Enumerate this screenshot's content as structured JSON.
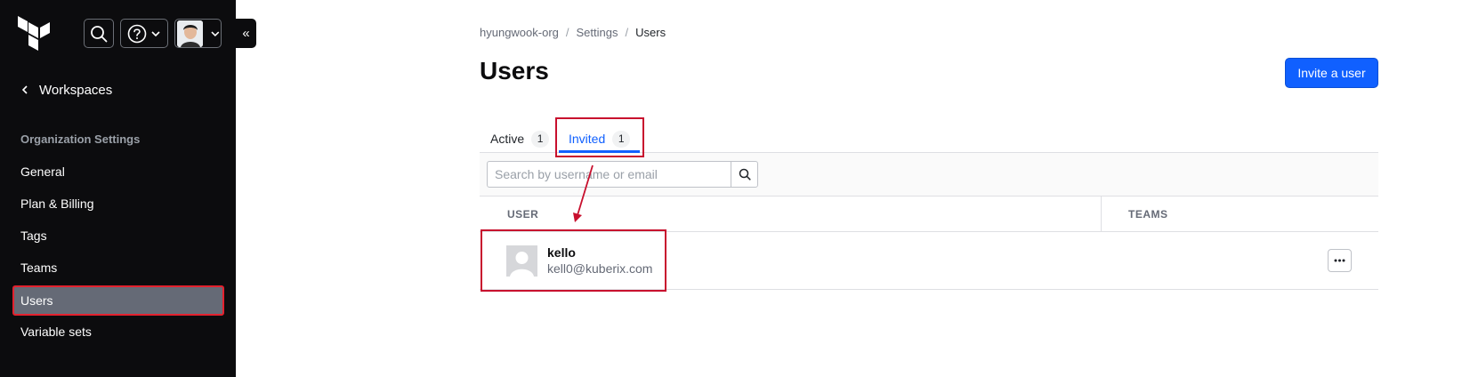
{
  "sidebar": {
    "back_label": "Workspaces",
    "section_label": "Organization Settings",
    "items": [
      {
        "label": "General"
      },
      {
        "label": "Plan & Billing"
      },
      {
        "label": "Tags"
      },
      {
        "label": "Teams"
      },
      {
        "label": "Users",
        "selected": true
      },
      {
        "label": "Variable sets"
      }
    ],
    "collapse_glyph": "«"
  },
  "header": {
    "icons": [
      "terraform-logo-icon",
      "search-icon",
      "help-icon",
      "chevron-down-icon",
      "avatar"
    ]
  },
  "breadcrumb": {
    "items": [
      "hyungwook-org",
      "Settings",
      "Users"
    ],
    "separator": "/"
  },
  "page": {
    "title": "Users",
    "invite_label": "Invite a user"
  },
  "tabs": [
    {
      "label": "Active",
      "count": "1",
      "active": false
    },
    {
      "label": "Invited",
      "count": "1",
      "active": true
    }
  ],
  "search": {
    "placeholder": "Search by username or email"
  },
  "table": {
    "columns": [
      "USER",
      "TEAMS"
    ],
    "rows": [
      {
        "name": "kello",
        "email": "kell0@kuberix.com"
      }
    ]
  },
  "colors": {
    "sidebar_bg": "#0c0c0e",
    "accent": "#1060ff",
    "annotation": "#c8102e",
    "selected_bg": "#656a76"
  }
}
